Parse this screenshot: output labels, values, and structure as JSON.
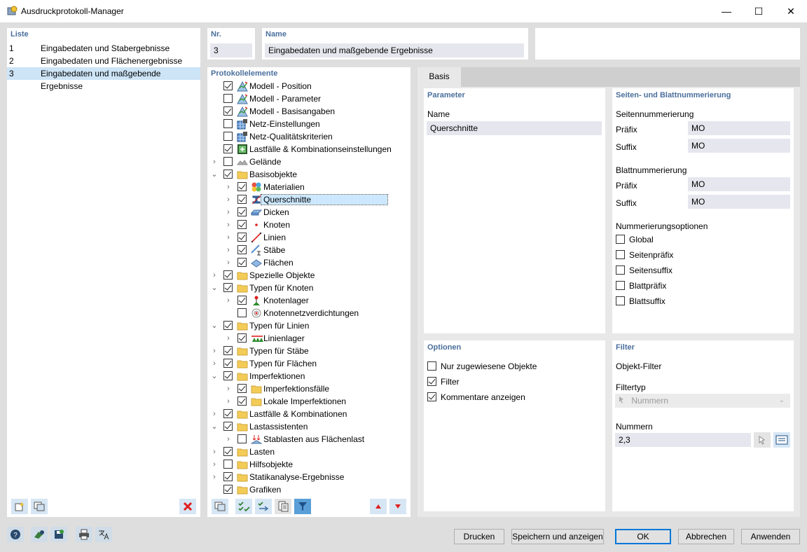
{
  "window": {
    "title": "Ausdruckprotokoll-Manager",
    "minimize": "—",
    "maximize": "☐",
    "close": "✕"
  },
  "list": {
    "header": "Liste",
    "items": [
      {
        "nr": "1",
        "label": "Eingabedaten und Stabergebnisse"
      },
      {
        "nr": "2",
        "label": "Eingabedaten und Flächenergebnisse"
      },
      {
        "nr": "3",
        "label": "Eingabedaten und maßgebende Ergebnisse"
      }
    ],
    "selected_index": 2
  },
  "nr": {
    "header": "Nr.",
    "value": "3"
  },
  "name": {
    "header": "Name",
    "value": "Eingabedaten und maßgebende Ergebnisse"
  },
  "protocol": {
    "header": "Protokollelemente",
    "items": [
      {
        "label": "Modell - Position",
        "checked": true,
        "level": 0,
        "expander": "",
        "icon": "model-icon"
      },
      {
        "label": "Modell - Parameter",
        "checked": false,
        "level": 0,
        "expander": "",
        "icon": "model-icon"
      },
      {
        "label": "Modell - Basisangaben",
        "checked": true,
        "level": 0,
        "expander": "",
        "icon": "model-icon"
      },
      {
        "label": "Netz-Einstellungen",
        "checked": false,
        "level": 0,
        "expander": "",
        "icon": "mesh-icon"
      },
      {
        "label": "Netz-Qualitätskriterien",
        "checked": false,
        "level": 0,
        "expander": "",
        "icon": "mesh-icon"
      },
      {
        "label": "Lastfälle & Kombinationseinstellungen",
        "checked": true,
        "level": 0,
        "expander": "",
        "icon": "loadcase-icon"
      },
      {
        "label": "Gelände",
        "checked": false,
        "level": 0,
        "expander": ">",
        "icon": "terrain-icon"
      },
      {
        "label": "Basisobjekte",
        "checked": true,
        "level": 0,
        "expander": "v",
        "icon": "folder-icon"
      },
      {
        "label": "Materialien",
        "checked": true,
        "level": 1,
        "expander": ">",
        "icon": "materials-icon"
      },
      {
        "label": "Querschnitte",
        "checked": true,
        "level": 1,
        "expander": ">",
        "icon": "section-icon",
        "selected": true
      },
      {
        "label": "Dicken",
        "checked": true,
        "level": 1,
        "expander": ">",
        "icon": "thickness-icon"
      },
      {
        "label": "Knoten",
        "checked": true,
        "level": 1,
        "expander": ">",
        "icon": "node-icon"
      },
      {
        "label": "Linien",
        "checked": true,
        "level": 1,
        "expander": ">",
        "icon": "line-icon"
      },
      {
        "label": "Stäbe",
        "checked": true,
        "level": 1,
        "expander": ">",
        "icon": "member-icon"
      },
      {
        "label": "Flächen",
        "checked": true,
        "level": 1,
        "expander": ">",
        "icon": "surface-icon"
      },
      {
        "label": "Spezielle Objekte",
        "checked": true,
        "level": 0,
        "expander": ">",
        "icon": "folder-icon"
      },
      {
        "label": "Typen für Knoten",
        "checked": true,
        "level": 0,
        "expander": "v",
        "icon": "folder-icon"
      },
      {
        "label": "Knotenlager",
        "checked": true,
        "level": 1,
        "expander": ">",
        "icon": "nodal-support-icon"
      },
      {
        "label": "Knotennetzverdichtungen",
        "checked": false,
        "level": 1,
        "expander": "",
        "icon": "mesh-refinement-icon"
      },
      {
        "label": "Typen für Linien",
        "checked": true,
        "level": 0,
        "expander": "v",
        "icon": "folder-icon"
      },
      {
        "label": "Linienlager",
        "checked": true,
        "level": 1,
        "expander": ">",
        "icon": "line-support-icon"
      },
      {
        "label": "Typen für Stäbe",
        "checked": true,
        "level": 0,
        "expander": ">",
        "icon": "folder-icon"
      },
      {
        "label": "Typen für Flächen",
        "checked": true,
        "level": 0,
        "expander": ">",
        "icon": "folder-icon"
      },
      {
        "label": "Imperfektionen",
        "checked": true,
        "level": 0,
        "expander": "v",
        "icon": "folder-icon"
      },
      {
        "label": "Imperfektionsfälle",
        "checked": true,
        "level": 1,
        "expander": ">",
        "icon": "folder-icon"
      },
      {
        "label": "Lokale Imperfektionen",
        "checked": true,
        "level": 1,
        "expander": ">",
        "icon": "folder-icon"
      },
      {
        "label": "Lastfälle & Kombinationen",
        "checked": true,
        "level": 0,
        "expander": ">",
        "icon": "folder-icon"
      },
      {
        "label": "Lastassistenten",
        "checked": true,
        "level": 0,
        "expander": "v",
        "icon": "folder-icon"
      },
      {
        "label": "Stablasten aus Flächenlast",
        "checked": false,
        "level": 1,
        "expander": ">",
        "icon": "load-wizard-icon"
      },
      {
        "label": "Lasten",
        "checked": true,
        "level": 0,
        "expander": ">",
        "icon": "folder-icon"
      },
      {
        "label": "Hilfsobjekte",
        "checked": false,
        "level": 0,
        "expander": ">",
        "icon": "folder-icon"
      },
      {
        "label": "Statikanalyse-Ergebnisse",
        "checked": true,
        "level": 0,
        "expander": ">",
        "icon": "folder-icon"
      },
      {
        "label": "Grafiken",
        "checked": true,
        "level": 0,
        "expander": "",
        "icon": "folder-icon"
      }
    ]
  },
  "tab": {
    "basis": "Basis"
  },
  "parameter": {
    "header": "Parameter",
    "name_label": "Name",
    "name_value": "Querschnitte"
  },
  "numbering": {
    "header": "Seiten- und Blattnummerierung",
    "page_header": "Seitennummerierung",
    "page_prefix_label": "Präfix",
    "page_prefix_value": "MO",
    "page_suffix_label": "Suffix",
    "page_suffix_value": "MO",
    "sheet_header": "Blattnummerierung",
    "sheet_prefix_label": "Präfix",
    "sheet_prefix_value": "MO",
    "sheet_suffix_label": "Suffix",
    "sheet_suffix_value": "MO",
    "options_header": "Nummerierungsoptionen",
    "options": [
      {
        "label": "Global",
        "checked": false
      },
      {
        "label": "Seitenpräfix",
        "checked": false
      },
      {
        "label": "Seitensuffix",
        "checked": false
      },
      {
        "label": "Blattpräfix",
        "checked": false
      },
      {
        "label": "Blattsuffix",
        "checked": false
      }
    ]
  },
  "options": {
    "header": "Optionen",
    "items": [
      {
        "label": "Nur zugewiesene Objekte",
        "checked": false
      },
      {
        "label": "Filter",
        "checked": true
      },
      {
        "label": "Kommentare anzeigen",
        "checked": true
      }
    ]
  },
  "filter": {
    "header": "Filter",
    "object_filter_label": "Objekt-Filter",
    "filter_type_label": "Filtertyp",
    "filter_type_value": "Nummern",
    "numbers_label": "Nummern",
    "numbers_value": "2,3"
  },
  "buttons": {
    "print": "Drucken",
    "save_show": "Speichern und anzeigen",
    "ok": "OK",
    "cancel": "Abbrechen",
    "apply": "Anwenden"
  },
  "colors": {
    "accent": "#0078d7",
    "header_text": "#4a6f9c",
    "selection": "#cde4f7",
    "delete": "#e02020"
  }
}
